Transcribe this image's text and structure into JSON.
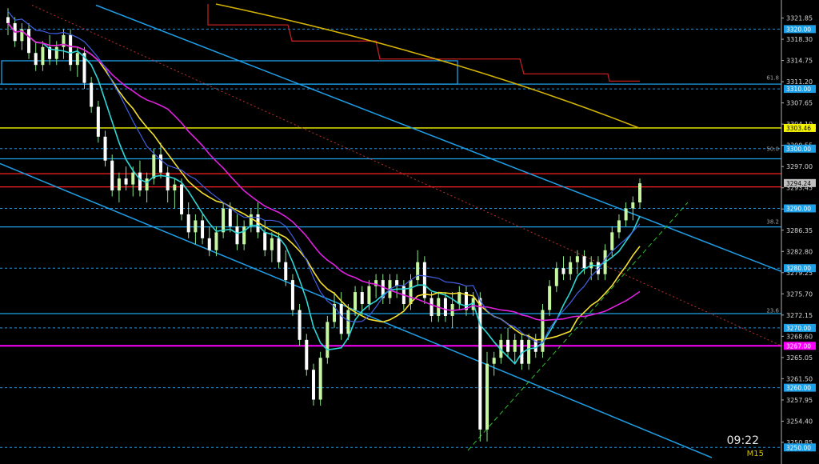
{
  "clock": "09:22",
  "timeframe": "M15",
  "colors": {
    "background": "#000000",
    "bull_candle": "#c6f7a0",
    "bear_candle": "#ffffff",
    "wick": "#8be58b",
    "cyan_ma": "#2fd6d6",
    "yellow_ma": "#f5e12e",
    "magenta_ma": "#e020e0",
    "slow_ma": "#d4b400",
    "channel": "#1ea0e8",
    "red_level": "#ff2020",
    "magenta_level": "#ff00ff",
    "yellow_level": "#f5f500",
    "blue_level": "#1ea0e8",
    "dotted_grid": "#2e8fcf",
    "step_red": "#c02020",
    "step_blue": "#4060e0"
  },
  "chart_data": {
    "type": "candlestick",
    "price_range": [
      3248.3,
      3324.2
    ],
    "y_ticks": [
      "3321.85",
      "3318.30",
      "3314.75",
      "3311.20",
      "3307.65",
      "3304.10",
      "3300.55",
      "3297.00",
      "3293.45",
      "3289.90",
      "3286.35",
      "3282.80",
      "3279.25",
      "3275.70",
      "3272.15",
      "3268.60",
      "3265.05",
      "3261.50",
      "3257.95",
      "3254.40",
      "3250.85"
    ],
    "price_tags": [
      {
        "label": "3320.00",
        "price": 3320.0,
        "color": "#1ea0e8",
        "text": "#ffffff"
      },
      {
        "label": "3310.00",
        "price": 3310.0,
        "color": "#1ea0e8",
        "text": "#ffffff"
      },
      {
        "label": "3303.46",
        "price": 3303.46,
        "color": "#f5f500",
        "text": "#000000"
      },
      {
        "label": "3300.00",
        "price": 3300.0,
        "color": "#1ea0e8",
        "text": "#ffffff"
      },
      {
        "label": "3294.24",
        "price": 3294.24,
        "color": "#c0c0c0",
        "text": "#000000"
      },
      {
        "label": "3290.00",
        "price": 3290.0,
        "color": "#1ea0e8",
        "text": "#ffffff"
      },
      {
        "label": "3280.00",
        "price": 3280.0,
        "color": "#1ea0e8",
        "text": "#ffffff"
      },
      {
        "label": "3270.00",
        "price": 3270.0,
        "color": "#1ea0e8",
        "text": "#ffffff"
      },
      {
        "label": "3267.00",
        "price": 3267.0,
        "color": "#ff00ff",
        "text": "#ffffff"
      },
      {
        "label": "3260.00",
        "price": 3260.0,
        "color": "#1ea0e8",
        "text": "#ffffff"
      },
      {
        "label": "3250.00",
        "price": 3250.0,
        "color": "#1ea0e8",
        "text": "#ffffff"
      }
    ],
    "fib_levels": [
      {
        "label": "61.8",
        "price": 3311.3
      },
      {
        "label": "50.0",
        "price": 3299.4
      },
      {
        "label": "38.2",
        "price": 3287.2
      },
      {
        "label": "23.6",
        "price": 3272.3
      }
    ],
    "horizontal_levels": [
      {
        "price": 3310.8,
        "color": "#1ea0e8",
        "style": "solid"
      },
      {
        "price": 3303.46,
        "color": "#f5f500",
        "style": "solid"
      },
      {
        "price": 3298.3,
        "color": "#1ea0e8",
        "style": "solid"
      },
      {
        "price": 3295.8,
        "color": "#ff2020",
        "style": "solid"
      },
      {
        "price": 3293.6,
        "color": "#ff2020",
        "style": "solid"
      },
      {
        "price": 3286.9,
        "color": "#1ea0e8",
        "style": "solid"
      },
      {
        "price": 3272.4,
        "color": "#1ea0e8",
        "style": "solid"
      },
      {
        "price": 3267.0,
        "color": "#ff00ff",
        "style": "solid"
      }
    ],
    "candles": [
      [
        3322,
        3323.5,
        3319,
        3321
      ],
      [
        3321,
        3322,
        3317,
        3318
      ],
      [
        3318,
        3321,
        3316.5,
        3320
      ],
      [
        3320,
        3321,
        3315,
        3316
      ],
      [
        3316,
        3318,
        3313,
        3314
      ],
      [
        3314,
        3318,
        3313,
        3317
      ],
      [
        3317,
        3319,
        3314,
        3315
      ],
      [
        3315,
        3318,
        3314,
        3317
      ],
      [
        3317,
        3320,
        3315,
        3319
      ],
      [
        3319,
        3320,
        3313,
        3314
      ],
      [
        3314,
        3317,
        3312,
        3316
      ],
      [
        3316,
        3317,
        3310,
        3311
      ],
      [
        3311,
        3312,
        3306,
        3307
      ],
      [
        3307,
        3308,
        3301,
        3302
      ],
      [
        3302,
        3303,
        3297,
        3298
      ],
      [
        3298,
        3299,
        3292,
        3293
      ],
      [
        3293,
        3296,
        3291,
        3295
      ],
      [
        3295,
        3297,
        3293,
        3294
      ],
      [
        3294,
        3297,
        3292,
        3296
      ],
      [
        3296,
        3298,
        3292,
        3293
      ],
      [
        3293,
        3296,
        3291,
        3295
      ],
      [
        3295,
        3300,
        3294,
        3299
      ],
      [
        3299,
        3301,
        3295,
        3296
      ],
      [
        3296,
        3297,
        3291,
        3293
      ],
      [
        3293,
        3295,
        3290,
        3294
      ],
      [
        3294,
        3295,
        3288,
        3289
      ],
      [
        3289,
        3291,
        3285,
        3286
      ],
      [
        3286,
        3289,
        3284,
        3288
      ],
      [
        3288,
        3289,
        3284,
        3285
      ],
      [
        3285,
        3287,
        3282,
        3283
      ],
      [
        3283,
        3287,
        3282,
        3286
      ],
      [
        3286,
        3291,
        3285,
        3290
      ],
      [
        3290,
        3291,
        3286,
        3287
      ],
      [
        3287,
        3289,
        3283,
        3284
      ],
      [
        3284,
        3288,
        3283,
        3287
      ],
      [
        3287,
        3290,
        3286,
        3289
      ],
      [
        3289,
        3291,
        3285,
        3286
      ],
      [
        3286,
        3288,
        3282,
        3283
      ],
      [
        3283,
        3286,
        3281,
        3285
      ],
      [
        3285,
        3286,
        3280,
        3281
      ],
      [
        3281,
        3283,
        3277,
        3278
      ],
      [
        3278,
        3279,
        3272,
        3273
      ],
      [
        3273,
        3274,
        3267,
        3268
      ],
      [
        3268,
        3269,
        3262,
        3263
      ],
      [
        3263,
        3264,
        3257,
        3258
      ],
      [
        3258,
        3266,
        3257,
        3265
      ],
      [
        3265,
        3272,
        3264,
        3271
      ],
      [
        3271,
        3276,
        3270,
        3274
      ],
      [
        3274,
        3276,
        3268,
        3269
      ],
      [
        3269,
        3274,
        3268,
        3273
      ],
      [
        3273,
        3277,
        3272,
        3276
      ],
      [
        3276,
        3277,
        3272,
        3274
      ],
      [
        3274,
        3278,
        3273,
        3277
      ],
      [
        3277,
        3279,
        3275,
        3278
      ],
      [
        3278,
        3279,
        3274,
        3275
      ],
      [
        3275,
        3279,
        3274,
        3278
      ],
      [
        3278,
        3279,
        3275,
        3277
      ],
      [
        3277,
        3278,
        3273,
        3274
      ],
      [
        3274,
        3279,
        3273,
        3278
      ],
      [
        3278,
        3283,
        3277,
        3281
      ],
      [
        3281,
        3282,
        3274,
        3275
      ],
      [
        3275,
        3276,
        3271,
        3272
      ],
      [
        3272,
        3276,
        3271,
        3275
      ],
      [
        3275,
        3276,
        3271,
        3272
      ],
      [
        3272,
        3276,
        3270,
        3274
      ],
      [
        3274,
        3277,
        3273,
        3276
      ],
      [
        3276,
        3277,
        3272,
        3273
      ],
      [
        3273,
        3276,
        3272,
        3275
      ],
      [
        3275,
        3276,
        3251,
        3253
      ],
      [
        3253,
        3266,
        3251,
        3264
      ],
      [
        3264,
        3266,
        3262,
        3265
      ],
      [
        3265,
        3269,
        3264,
        3268
      ],
      [
        3268,
        3270,
        3265,
        3266
      ],
      [
        3266,
        3269,
        3264,
        3268
      ],
      [
        3268,
        3269,
        3263,
        3264
      ],
      [
        3264,
        3269,
        3263,
        3268
      ],
      [
        3268,
        3269,
        3265,
        3266
      ],
      [
        3266,
        3274,
        3265,
        3273
      ],
      [
        3273,
        3278,
        3272,
        3277
      ],
      [
        3277,
        3281,
        3276,
        3280
      ],
      [
        3280,
        3282,
        3278,
        3279
      ],
      [
        3279,
        3282,
        3278,
        3281
      ],
      [
        3281,
        3283,
        3279,
        3282
      ],
      [
        3282,
        3283,
        3279,
        3280
      ],
      [
        3280,
        3282,
        3278,
        3281
      ],
      [
        3281,
        3282,
        3278,
        3279
      ],
      [
        3279,
        3284,
        3278,
        3283
      ],
      [
        3283,
        3287,
        3282,
        3286
      ],
      [
        3286,
        3289,
        3285,
        3288
      ],
      [
        3288,
        3291,
        3287,
        3290
      ],
      [
        3290,
        3292,
        3288,
        3291
      ],
      [
        3291,
        3295,
        3290,
        3294.2
      ]
    ]
  }
}
